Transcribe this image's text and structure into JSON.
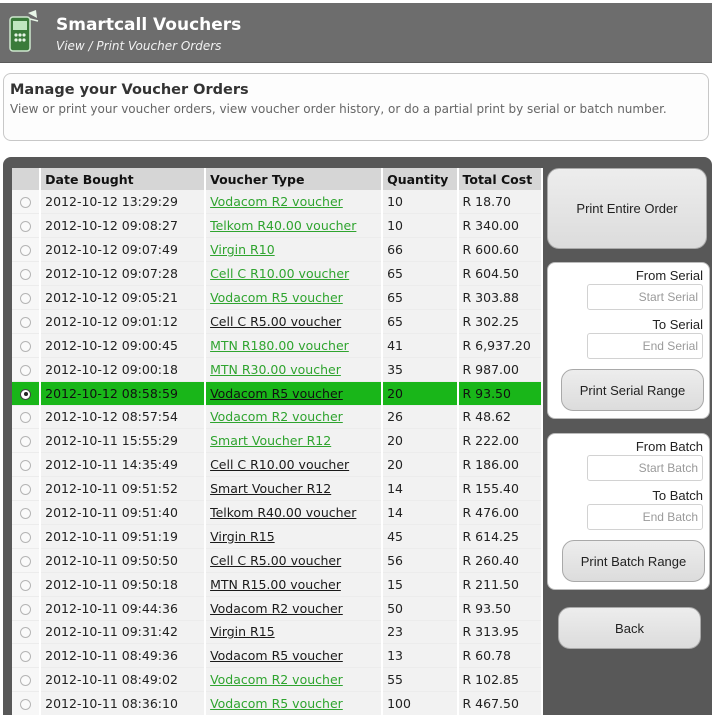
{
  "header": {
    "title": "Smartcall Vouchers",
    "subtitle": "View / Print Voucher Orders"
  },
  "intro": {
    "title": "Manage your Voucher Orders",
    "description": "View or print your voucher orders, view voucher order history, or do a partial print by serial or batch number."
  },
  "table": {
    "columns": [
      "Date Bought",
      "Voucher Type",
      "Quantity",
      "Total Cost"
    ],
    "rows": [
      {
        "date": "2012-10-12 13:29:29",
        "type": "Vodacom R2 voucher",
        "qty": "10",
        "cost": "R 18.70",
        "link_color": "green",
        "selected": false
      },
      {
        "date": "2012-10-12 09:08:27",
        "type": "Telkom R40.00 voucher",
        "qty": "10",
        "cost": "R 340.00",
        "link_color": "green",
        "selected": false
      },
      {
        "date": "2012-10-12 09:07:49",
        "type": "Virgin R10",
        "qty": "66",
        "cost": "R 600.60",
        "link_color": "green",
        "selected": false
      },
      {
        "date": "2012-10-12 09:07:28",
        "type": "Cell C R10.00 voucher",
        "qty": "65",
        "cost": "R 604.50",
        "link_color": "green",
        "selected": false
      },
      {
        "date": "2012-10-12 09:05:21",
        "type": "Vodacom R5 voucher",
        "qty": "65",
        "cost": "R 303.88",
        "link_color": "green",
        "selected": false
      },
      {
        "date": "2012-10-12 09:01:12",
        "type": "Cell C R5.00 voucher",
        "qty": "65",
        "cost": "R 302.25",
        "link_color": "black",
        "selected": false
      },
      {
        "date": "2012-10-12 09:00:45",
        "type": "MTN R180.00 voucher",
        "qty": "41",
        "cost": "R 6,937.20",
        "link_color": "green",
        "selected": false
      },
      {
        "date": "2012-10-12 09:00:18",
        "type": "MTN R30.00 voucher",
        "qty": "35",
        "cost": "R 987.00",
        "link_color": "green",
        "selected": false
      },
      {
        "date": "2012-10-12 08:58:59",
        "type": "Vodacom R5 voucher",
        "qty": "20",
        "cost": "R 93.50",
        "link_color": "green",
        "selected": true
      },
      {
        "date": "2012-10-12 08:57:54",
        "type": "Vodacom R2 voucher",
        "qty": "26",
        "cost": "R 48.62",
        "link_color": "green",
        "selected": false
      },
      {
        "date": "2012-10-11 15:55:29",
        "type": "Smart Voucher R12",
        "qty": "20",
        "cost": "R 222.00",
        "link_color": "green",
        "selected": false
      },
      {
        "date": "2012-10-11 14:35:49",
        "type": "Cell C R10.00 voucher",
        "qty": "20",
        "cost": "R 186.00",
        "link_color": "black",
        "selected": false
      },
      {
        "date": "2012-10-11 09:51:52",
        "type": "Smart Voucher R12",
        "qty": "14",
        "cost": "R 155.40",
        "link_color": "black",
        "selected": false
      },
      {
        "date": "2012-10-11 09:51:40",
        "type": "Telkom R40.00 voucher",
        "qty": "14",
        "cost": "R 476.00",
        "link_color": "black",
        "selected": false
      },
      {
        "date": "2012-10-11 09:51:19",
        "type": "Virgin R15",
        "qty": "45",
        "cost": "R 614.25",
        "link_color": "black",
        "selected": false
      },
      {
        "date": "2012-10-11 09:50:50",
        "type": "Cell C R5.00 voucher",
        "qty": "56",
        "cost": "R 260.40",
        "link_color": "black",
        "selected": false
      },
      {
        "date": "2012-10-11 09:50:18",
        "type": "MTN R15.00 voucher",
        "qty": "15",
        "cost": "R 211.50",
        "link_color": "black",
        "selected": false
      },
      {
        "date": "2012-10-11 09:44:36",
        "type": "Vodacom R2 voucher",
        "qty": "50",
        "cost": "R 93.50",
        "link_color": "black",
        "selected": false
      },
      {
        "date": "2012-10-11 09:31:42",
        "type": "Virgin R15",
        "qty": "23",
        "cost": "R 313.95",
        "link_color": "black",
        "selected": false
      },
      {
        "date": "2012-10-11 08:49:36",
        "type": "Vodacom R5 voucher",
        "qty": "13",
        "cost": "R 60.78",
        "link_color": "black",
        "selected": false
      },
      {
        "date": "2012-10-11 08:49:02",
        "type": "Vodacom R2 voucher",
        "qty": "55",
        "cost": "R 102.85",
        "link_color": "green",
        "selected": false
      },
      {
        "date": "2012-10-11 08:36:10",
        "type": "Vodacom R5 voucher",
        "qty": "100",
        "cost": "R 467.50",
        "link_color": "green",
        "selected": false
      }
    ]
  },
  "actions": {
    "print_entire": "Print Entire Order",
    "from_serial_label": "From Serial",
    "start_serial_placeholder": "Start Serial",
    "to_serial_label": "To Serial",
    "end_serial_placeholder": "End Serial",
    "print_serial_range": "Print Serial Range",
    "from_batch_label": "From Batch",
    "start_batch_placeholder": "Start Batch",
    "to_batch_label": "To Batch",
    "end_batch_placeholder": "End Batch",
    "print_batch_range": "Print Batch Range",
    "back": "Back"
  },
  "colors": {
    "header_bg": "#6d6d6d",
    "content_bg": "#585858",
    "selected_row": "#19b619",
    "link_green": "#2fa42f"
  }
}
